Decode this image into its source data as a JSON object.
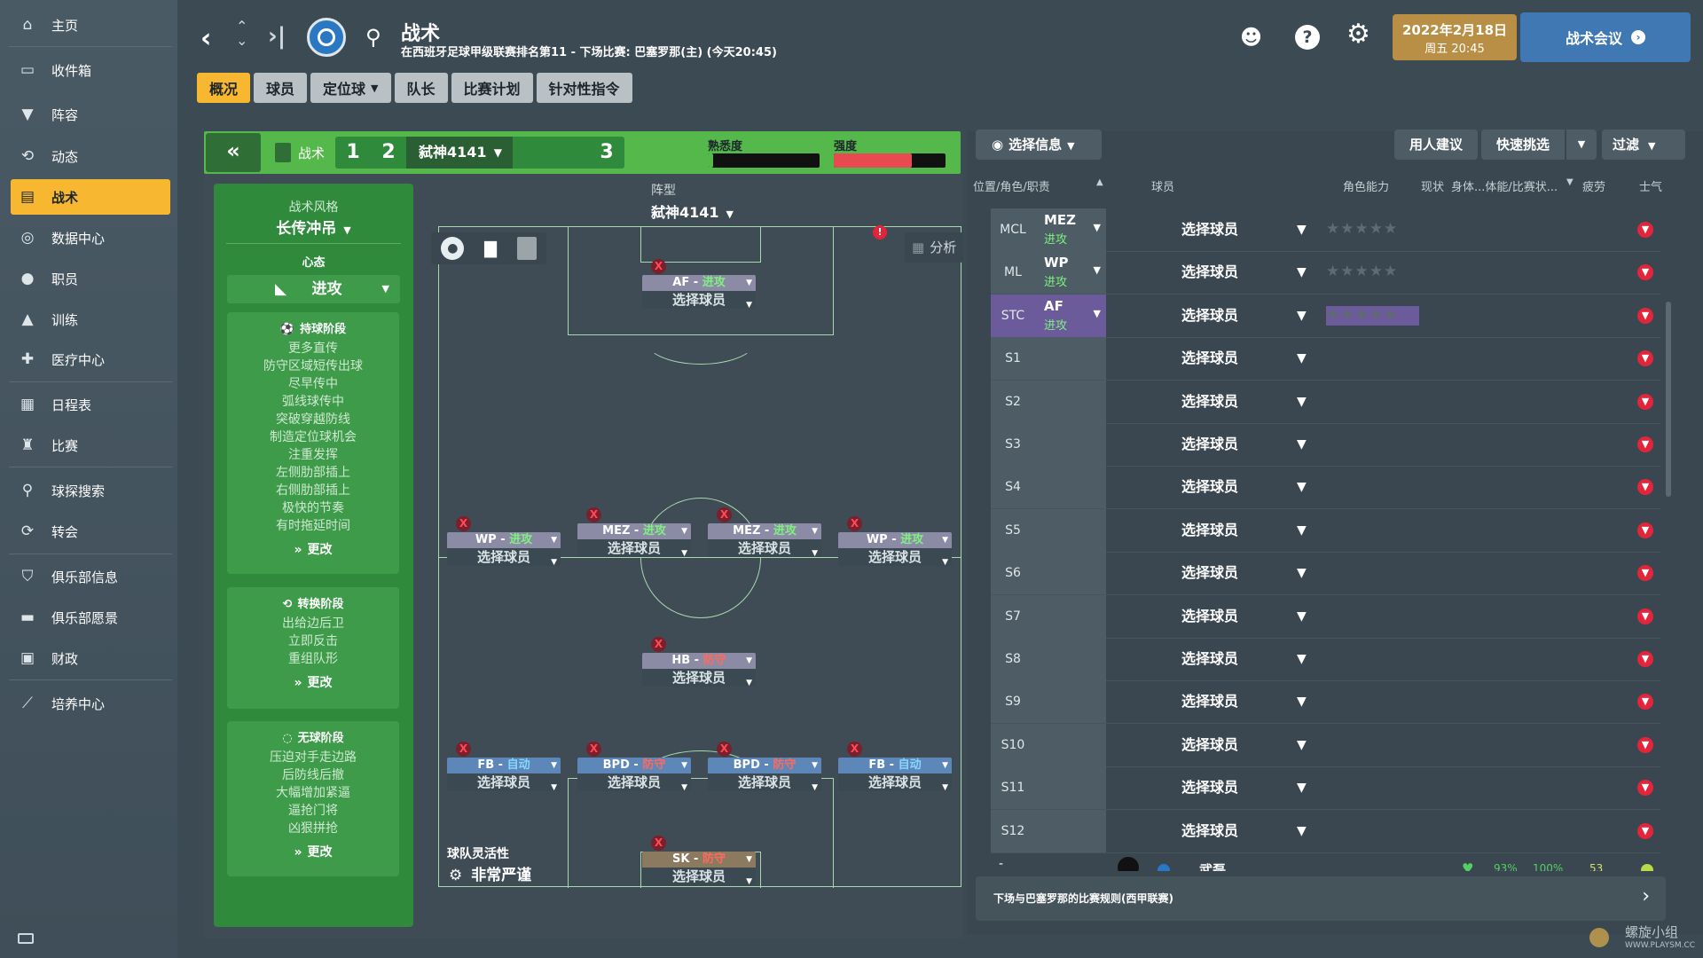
{
  "sidebar": {
    "items": [
      {
        "label": "主页",
        "icon": "home-icon"
      },
      {
        "label": "收件箱",
        "icon": "inbox-icon"
      },
      {
        "label": "阵容",
        "icon": "shirt-icon"
      },
      {
        "label": "动态",
        "icon": "activity-icon"
      },
      {
        "label": "战术",
        "icon": "tactics-icon"
      },
      {
        "label": "数据中心",
        "icon": "data-icon"
      },
      {
        "label": "职员",
        "icon": "staff-icon"
      },
      {
        "label": "训练",
        "icon": "training-icon"
      },
      {
        "label": "医疗中心",
        "icon": "medical-icon"
      },
      {
        "label": "日程表",
        "icon": "calendar-icon"
      },
      {
        "label": "比赛",
        "icon": "trophy-icon"
      },
      {
        "label": "球探搜索",
        "icon": "search-icon"
      },
      {
        "label": "转会",
        "icon": "transfer-icon"
      },
      {
        "label": "俱乐部信息",
        "icon": "shield-icon"
      },
      {
        "label": "俱乐部愿景",
        "icon": "briefcase-icon"
      },
      {
        "label": "财政",
        "icon": "money-icon"
      },
      {
        "label": "培养中心",
        "icon": "growth-icon"
      }
    ]
  },
  "header": {
    "title": "战术",
    "subtitle": "在西班牙足球甲级联赛排名第11 - 下场比赛: 巴塞罗那(主) (今天20:45)",
    "date": "2022年2月18日",
    "day_time": "周五 20:45",
    "meeting_button": "战术会议"
  },
  "tabs": [
    "概况",
    "球员",
    "定位球",
    "队长",
    "比赛计划",
    "针对性指令"
  ],
  "tactic_bar": {
    "tactics_label": "战术",
    "slot1": "1",
    "slot2": "2",
    "tactic_name": "弑神4141",
    "slot3": "3",
    "familiarity_label": "熟悉度",
    "intensity_label": "强度",
    "familiarity": 0.05,
    "intensity": 0.7
  },
  "style": {
    "style_label": "战术风格",
    "style_value": "长传冲吊",
    "mentality_label": "心态",
    "mentality_value": "进攻"
  },
  "in_possession": {
    "title": "持球阶段",
    "lines": [
      "更多直传",
      "防守区域短传出球",
      "尽早传中",
      "弧线球传中",
      "突破穿越防线",
      "制造定位球机会",
      "注重发挥",
      "左侧肋部插上",
      "右侧肋部插上",
      "极快的节奏",
      "有时拖延时间"
    ],
    "change": "更改"
  },
  "transition": {
    "title": "转换阶段",
    "lines": [
      "出给边后卫",
      "立即反击",
      "重组队形"
    ],
    "change": "更改"
  },
  "out_possession": {
    "title": "无球阶段",
    "lines": [
      "压迫对手走边路",
      "后防线后撤",
      "大幅增加紧逼",
      "逼抢门将",
      "凶狠拼抢"
    ],
    "change": "更改"
  },
  "pitch": {
    "formation_label": "阵型",
    "formation_value": "弑神4141",
    "analysis": "分析",
    "flex_label": "球队灵活性",
    "flex_value": "非常严谨",
    "select": "选择球员",
    "players": [
      {
        "role": "AF",
        "duty": "进攻",
        "cls": "att",
        "dcls": "m"
      },
      {
        "role": "WP",
        "duty": "进攻",
        "cls": "att",
        "dcls": "m"
      },
      {
        "role": "MEZ",
        "duty": "进攻",
        "cls": "att",
        "dcls": "m"
      },
      {
        "role": "MEZ",
        "duty": "进攻",
        "cls": "att",
        "dcls": "m"
      },
      {
        "role": "WP",
        "duty": "进攻",
        "cls": "att",
        "dcls": "m"
      },
      {
        "role": "HB",
        "duty": "防守",
        "cls": "att",
        "dcls": "d"
      },
      {
        "role": "FB",
        "duty": "自动",
        "cls": "fb",
        "dcls": "a"
      },
      {
        "role": "BPD",
        "duty": "防守",
        "cls": "fb",
        "dcls": "d"
      },
      {
        "role": "BPD",
        "duty": "防守",
        "cls": "fb",
        "dcls": "d"
      },
      {
        "role": "FB",
        "duty": "自动",
        "cls": "fb",
        "dcls": "a"
      },
      {
        "role": "SK",
        "duty": "防守",
        "cls": "gk",
        "dcls": "d"
      }
    ]
  },
  "right": {
    "select_info": "选择信息",
    "advice": "用人建议",
    "quick_pick": "快速挑选",
    "filter": "过滤",
    "col_position": "位置/角色/职责",
    "col_player": "球员",
    "col_role_ability": "角色能力",
    "col_condition": "现状",
    "col_fitness": "身体...体能/比赛状...",
    "col_injury": "疲劳",
    "col_morale": "士气",
    "rows": [
      {
        "pos": "MCL",
        "role": "MEZ",
        "duty": "进攻"
      },
      {
        "pos": "ML",
        "role": "WP",
        "duty": "进攻"
      },
      {
        "pos": "STC",
        "role": "AF",
        "duty": "进攻"
      },
      {
        "pos": "S1"
      },
      {
        "pos": "S2"
      },
      {
        "pos": "S3"
      },
      {
        "pos": "S4"
      },
      {
        "pos": "S5"
      },
      {
        "pos": "S6"
      },
      {
        "pos": "S7"
      },
      {
        "pos": "S8"
      },
      {
        "pos": "S9"
      },
      {
        "pos": "S10"
      },
      {
        "pos": "S11"
      },
      {
        "pos": "S12"
      }
    ],
    "select": "选择球员",
    "partial_player": "武磊",
    "partial_pct1": "93%",
    "partial_pct2": "100%",
    "partial_num": "53",
    "bottom_rule": "下场与巴塞罗那的比赛规则(西甲联赛)"
  },
  "watermark": "螺旋小组",
  "watermark_url": "WWW.PLAYSM.CC"
}
